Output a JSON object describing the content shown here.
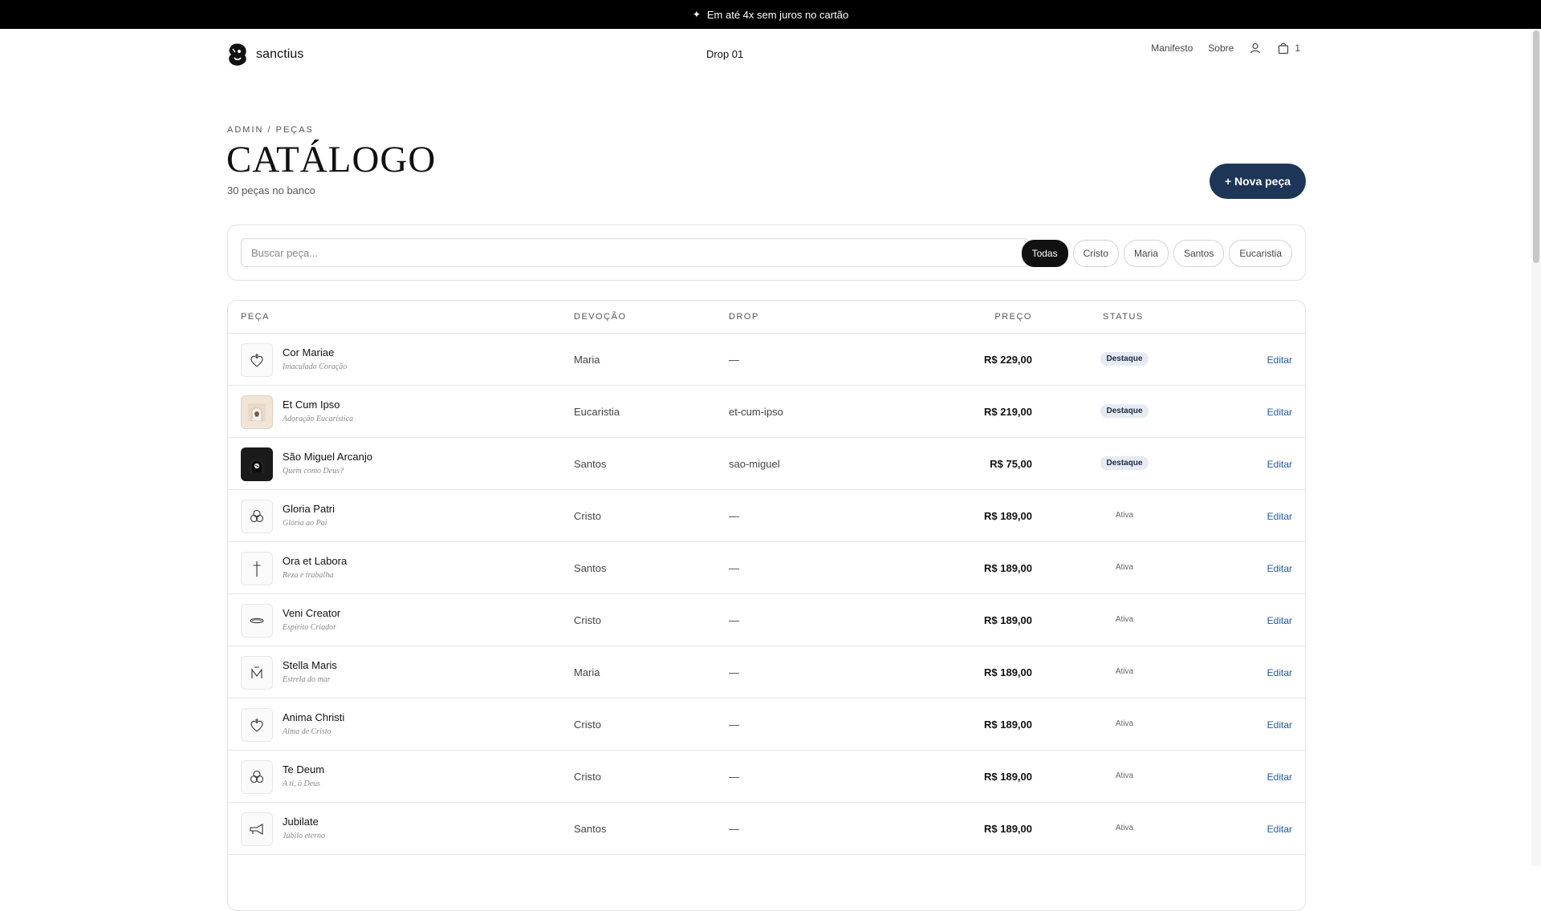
{
  "promo": {
    "icon": "sparkle-icon",
    "text": "Em até 4x sem juros no cartão"
  },
  "header": {
    "brand": "sanctius",
    "drop": "Drop 01",
    "nav": {
      "manifesto": "Manifesto",
      "sobre": "Sobre"
    },
    "cart_count": "1"
  },
  "page": {
    "breadcrumb": "ADMIN / PEÇAS",
    "title": "CATÁLOGO",
    "count": "30 peças no banco",
    "new_button": "+ Nova peça"
  },
  "search": {
    "placeholder": "Buscar peça...",
    "filters": [
      {
        "label": "Todas",
        "active": true
      },
      {
        "label": "Cristo",
        "active": false
      },
      {
        "label": "Maria",
        "active": false
      },
      {
        "label": "Santos",
        "active": false
      },
      {
        "label": "Eucaristia",
        "active": false
      }
    ]
  },
  "table": {
    "headers": {
      "peca": "PEÇA",
      "devocao": "DEVOÇÃO",
      "drop": "DROP",
      "preco": "PREÇO",
      "status": "STATUS"
    },
    "edit_label": "Editar",
    "rows": [
      {
        "icon": "heart-icon",
        "name": "Cor Mariae",
        "subtitle": "Imaculado Coração",
        "devocao": "Maria",
        "drop": "—",
        "preco": "R$ 229,00",
        "status": "Destaque",
        "featured": true
      },
      {
        "icon": "product-photo-icon",
        "name": "Et Cum Ipso",
        "subtitle": "Adoração Eucarística",
        "devocao": "Eucaristia",
        "drop": "et-cum-ipso",
        "preco": "R$ 219,00",
        "status": "Destaque",
        "featured": true
      },
      {
        "icon": "product-photo-dark-icon",
        "name": "São Miguel Arcanjo",
        "subtitle": "Quem como Deus?",
        "devocao": "Santos",
        "drop": "sao-miguel",
        "preco": "R$ 75,00",
        "status": "Destaque",
        "featured": true
      },
      {
        "icon": "trinity-icon",
        "name": "Gloria Patri",
        "subtitle": "Glória ao Pai",
        "devocao": "Cristo",
        "drop": "—",
        "preco": "R$ 189,00",
        "status": "Ativa",
        "featured": false
      },
      {
        "icon": "cross-icon",
        "name": "Ora et Labora",
        "subtitle": "Reza e trabalha",
        "devocao": "Santos",
        "drop": "—",
        "preco": "R$ 189,00",
        "status": "Ativa",
        "featured": false
      },
      {
        "icon": "flame-icon",
        "name": "Veni Creator",
        "subtitle": "Espírito Criador",
        "devocao": "Cristo",
        "drop": "—",
        "preco": "R$ 189,00",
        "status": "Ativa",
        "featured": false
      },
      {
        "icon": "marian-monogram-icon",
        "name": "Stella Maris",
        "subtitle": "Estrela do mar",
        "devocao": "Maria",
        "drop": "—",
        "preco": "R$ 189,00",
        "status": "Ativa",
        "featured": false
      },
      {
        "icon": "heart-icon",
        "name": "Anima Christi",
        "subtitle": "Alma de Cristo",
        "devocao": "Cristo",
        "drop": "—",
        "preco": "R$ 189,00",
        "status": "Ativa",
        "featured": false
      },
      {
        "icon": "trinity-icon",
        "name": "Te Deum",
        "subtitle": "A ti, ó Deus",
        "devocao": "Cristo",
        "drop": "—",
        "preco": "R$ 189,00",
        "status": "Ativa",
        "featured": false
      },
      {
        "icon": "trumpet-icon",
        "name": "Jubilate",
        "subtitle": "Júbilo eterno",
        "devocao": "Santos",
        "drop": "—",
        "preco": "R$ 189,00",
        "status": "Ativa",
        "featured": false
      }
    ]
  }
}
